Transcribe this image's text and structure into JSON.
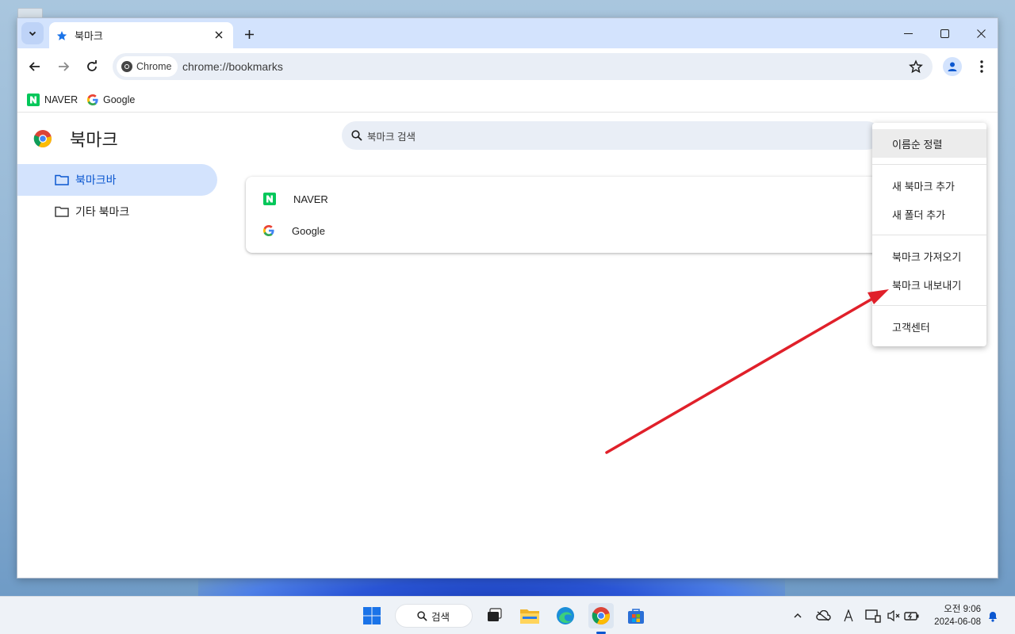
{
  "tab": {
    "title": "북마크"
  },
  "address": {
    "chip_label": "Chrome",
    "url": "chrome://bookmarks"
  },
  "bookmarks_bar": [
    {
      "label": "NAVER"
    },
    {
      "label": "Google"
    }
  ],
  "page": {
    "title": "북마크",
    "search_placeholder": "북마크 검색"
  },
  "sidebar": [
    {
      "label": "북마크바",
      "active": true
    },
    {
      "label": "기타 북마크",
      "active": false
    }
  ],
  "list": [
    {
      "label": "NAVER"
    },
    {
      "label": "Google"
    }
  ],
  "menu": {
    "items": [
      {
        "label": "이름순 정렬"
      },
      {
        "label": "새 북마크 추가"
      },
      {
        "label": "새 폴더 추가"
      },
      {
        "label": "북마크 가져오기"
      },
      {
        "label": "북마크 내보내기"
      },
      {
        "label": "고객센터"
      }
    ]
  },
  "taskbar": {
    "search_label": "검색",
    "time": "오전 9:06",
    "date": "2024-06-08"
  },
  "colors": {
    "accent": "#0b57d0",
    "naver_green": "#03c75a",
    "annotation_red": "#e0202a"
  }
}
